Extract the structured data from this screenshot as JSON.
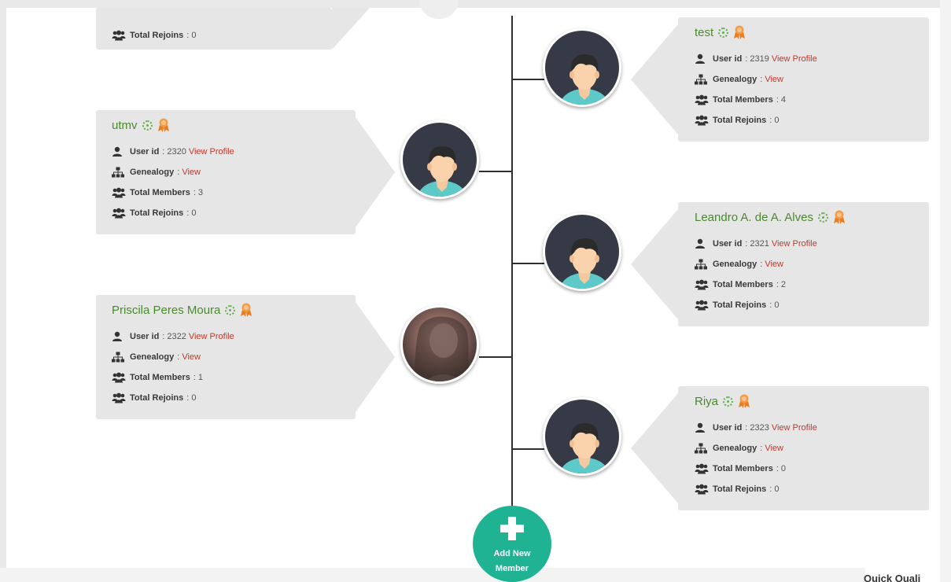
{
  "cards": {
    "top_partial": {
      "rejoins_label": "Total Rejoins",
      "rejoins_value": "0"
    },
    "test": {
      "name": "test",
      "user_id_label": "User id",
      "user_id": "2319",
      "view_profile": "View Profile",
      "genealogy_label": "Genealogy",
      "genealogy_link": "View",
      "members_label": "Total Members",
      "members_value": "4",
      "rejoins_label": "Total Rejoins",
      "rejoins_value": "0"
    },
    "utmv": {
      "name": "utmv",
      "user_id_label": "User id",
      "user_id": "2320",
      "view_profile": "View Profile",
      "genealogy_label": "Genealogy",
      "genealogy_link": "View",
      "members_label": "Total Members",
      "members_value": "3",
      "rejoins_label": "Total Rejoins",
      "rejoins_value": "0"
    },
    "leandro": {
      "name": "Leandro A. de A. Alves",
      "user_id_label": "User id",
      "user_id": "2321",
      "view_profile": "View Profile",
      "genealogy_label": "Genealogy",
      "genealogy_link": "View",
      "members_label": "Total Members",
      "members_value": "2",
      "rejoins_label": "Total Rejoins",
      "rejoins_value": "0"
    },
    "priscila": {
      "name": "Priscila Peres Moura",
      "user_id_label": "User id",
      "user_id": "2322",
      "view_profile": "View Profile",
      "genealogy_label": "Genealogy",
      "genealogy_link": "View",
      "members_label": "Total Members",
      "members_value": "1",
      "rejoins_label": "Total Rejoins",
      "rejoins_value": "0"
    },
    "riya": {
      "name": "Riya",
      "user_id_label": "User id",
      "user_id": "2323",
      "view_profile": "View Profile",
      "genealogy_label": "Genealogy",
      "genealogy_link": "View",
      "members_label": "Total Members",
      "members_value": "0",
      "rejoins_label": "Total Rejoins",
      "rejoins_value": "0"
    }
  },
  "add_member": {
    "line1": "Add New",
    "line2": "Member",
    "icon": "plus-icon"
  },
  "peek_text": "Quick Quali",
  "colors": {
    "name": "#4a8a2e",
    "link": "#c0392b",
    "card": "#e6e6e6",
    "add_button": "#1fb394",
    "avatar_bg": "#363a46"
  },
  "icons": [
    "user-icon",
    "sitemap-icon",
    "users-icon",
    "online-status-icon",
    "award-badge-icon",
    "default-avatar-icon"
  ]
}
